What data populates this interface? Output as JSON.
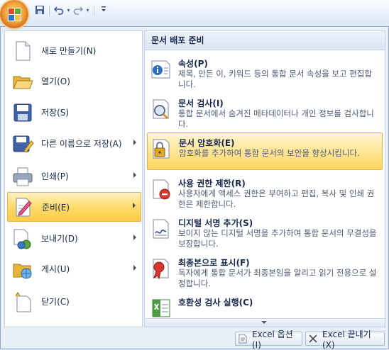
{
  "left_menu": [
    {
      "label": "새로 만들기(N)",
      "icon": "new-document-icon",
      "has_submenu": false
    },
    {
      "label": "열기(O)",
      "icon": "open-folder-icon",
      "has_submenu": false
    },
    {
      "label": "저장(S)",
      "icon": "save-disk-icon",
      "has_submenu": false
    },
    {
      "label": "다른 이름으로 저장(A)",
      "icon": "save-as-icon",
      "has_submenu": true
    },
    {
      "label": "인쇄(P)",
      "icon": "printer-icon",
      "has_submenu": true
    },
    {
      "label": "준비(E)",
      "icon": "prepare-icon",
      "has_submenu": true,
      "selected": true
    },
    {
      "label": "보내기(D)",
      "icon": "send-icon",
      "has_submenu": true
    },
    {
      "label": "게시(U)",
      "icon": "publish-icon",
      "has_submenu": true
    },
    {
      "label": "닫기(C)",
      "icon": "close-document-icon",
      "has_submenu": false
    }
  ],
  "submenu": {
    "header": "문서 배포 준비",
    "items": [
      {
        "title": "속성(P)",
        "desc": "제목, 만든 이, 키워드 등의 통합 문서 속성을 보고 편집합니다.",
        "icon": "properties-icon"
      },
      {
        "title": "문서 검사(I)",
        "desc": "통합 문서에서 숨겨진 메타데이터나 개인 정보를 검사합니다.",
        "icon": "inspect-document-icon"
      },
      {
        "title": "문서 암호화(E)",
        "desc": "암호화를 추가하여 통합 문서의 보안을 향상시킵니다.",
        "icon": "encrypt-lock-icon",
        "selected": true
      },
      {
        "title": "사용 권한 제한(R)",
        "desc": "사용자에게 액세스 권한은 부여하고 편집, 복사 및 인쇄 권한은 제한합니다.",
        "icon": "restrict-permission-icon"
      },
      {
        "title": "디지털 서명 추가(S)",
        "desc": "보이지 않는 디지털 서명을 추가하여 통합 문서의 무결성을 보장합니다.",
        "icon": "digital-signature-icon"
      },
      {
        "title": "최종본으로 표시(F)",
        "desc": "독자에게 통합 문서가 최종본임을 알리고 읽기 전용으로 설정합니다.",
        "icon": "mark-final-icon"
      },
      {
        "title": "호환성 검사 실행(C)",
        "desc": "",
        "icon": "compatibility-check-icon"
      }
    ]
  },
  "bottom_buttons": {
    "options": "Excel 옵션(I)",
    "exit": "Excel 끝내기(X)"
  },
  "quick_access": {
    "save_icon": "save-icon",
    "undo_icon": "undo-icon",
    "redo_icon": "redo-icon",
    "customize_icon": "customize-dropdown-icon"
  }
}
